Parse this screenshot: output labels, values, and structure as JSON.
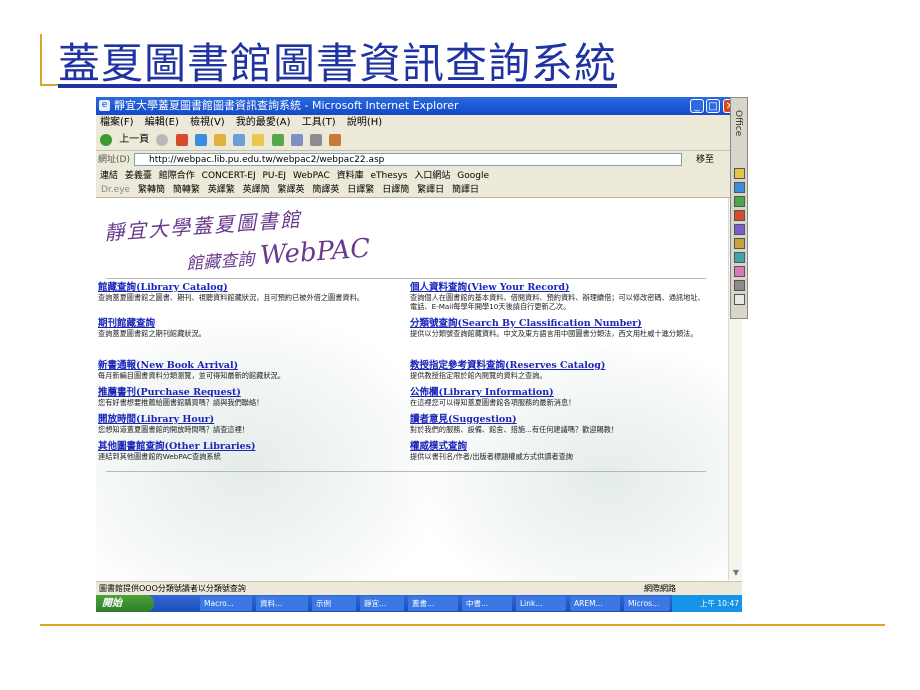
{
  "slide": {
    "title": "蓋夏圖書館圖書資訊查詢系統"
  },
  "window": {
    "title": "靜宜大學蓋夏圖書館圖書資訊查詢系統 - Microsoft Internet Explorer",
    "menu": [
      "檔案(F)",
      "編輯(E)",
      "檢視(V)",
      "我的最愛(A)",
      "工具(T)",
      "說明(H)"
    ],
    "toolbar": {
      "back": "上一頁"
    },
    "address": {
      "label": "網址(D)",
      "url": "http://webpac.lib.pu.edu.tw/webpac2/webpac22.asp",
      "go": "移至"
    },
    "links": {
      "label": "連結",
      "items": [
        "姜義臺",
        "館際合作",
        "CONCERT-EJ",
        "PU-EJ",
        "WebPAC",
        "資料庫",
        "eThesys",
        "入口網站",
        "Google"
      ]
    },
    "dict": {
      "label": "Dr.eye",
      "items": [
        "繁轉簡",
        "簡轉繁",
        "英譯繁",
        "英譯簡",
        "繁譯英",
        "簡譯英",
        "日譯繁",
        "日譯簡",
        "繁譯日",
        "簡譯日"
      ]
    }
  },
  "logo": {
    "line1": "靜宜大學蓋夏圖書館",
    "line2": "館藏查詢",
    "webpac": "WebPAC"
  },
  "entries_left": [
    {
      "title": "館藏查詢(Library Catalog)",
      "desc": "查詢蓋夏圖書館之圖書、期刊、視聽資料館藏狀況，且可預約已被外借之圖書資料。"
    },
    {
      "title": "期刊館藏查詢",
      "desc": "查詢蓋夏圖書館之期刊館藏狀況。"
    },
    {
      "title": "新書通報(New Book Arrival)",
      "desc": "每月新編目圖書資料分類瀏覽，並可得知最新的館藏狀況。"
    },
    {
      "title": "推薦書刊(Purchase Request)",
      "desc": "您有好書想要推薦給圖書館購買嗎？請與我們聯絡！"
    },
    {
      "title": "開放時間(Library Hour)",
      "desc": "您想知道蓋夏圖書館的開放時間嗎？請查這裡！"
    },
    {
      "title": "其他圖書館查詢(Other Libraries)",
      "desc": "連結到其他圖書館的WebPAC查詢系統"
    }
  ],
  "entries_right": [
    {
      "title": "個人資料查詢(View Your Record)",
      "desc": "查詢個人在圖書館的基本資料、借閱資料、預約資料、辦理續借；可以修改密碼、通訊地址、電話、E-Mail每學年開學10天後請自行更新乙次。"
    },
    {
      "title": "分類號查詢(Search By Classification Number)",
      "desc": "提供以分類號查詢館藏資料。中文及東方語言用中國圖書分類法，西文用杜威十進分類法。"
    },
    {
      "title": "教授指定參考資料查詢(Reserves Catalog)",
      "desc": "提供教授指定限於館內閱覽的資料之查詢。"
    },
    {
      "title": "公佈欄(Library Information)",
      "desc": "在這裡您可以得知蓋夏圖書館各項服務的最新消息！"
    },
    {
      "title": "讀者意見(Suggestion)",
      "desc": "對於我們的服務、設備、館舍、措施...有任何建議嗎？歡迎賜教！"
    },
    {
      "title": "權威模式查詢",
      "desc": "提供以書刊名/作者/出版者標題權威方式供讀者查詢"
    }
  ],
  "status": {
    "text": "圖書館提供OOO分類號讀者以分類號查詢",
    "zone": "網際網路"
  },
  "taskbar": {
    "start": "開始",
    "tasks": [
      "Macro...",
      "資料...",
      "示例",
      "靜宜...",
      "蓋書...",
      "中書...",
      "Link...",
      "AREM...",
      "Micros..."
    ],
    "clock": "上午 10:47"
  },
  "office": {
    "label": "Office"
  }
}
